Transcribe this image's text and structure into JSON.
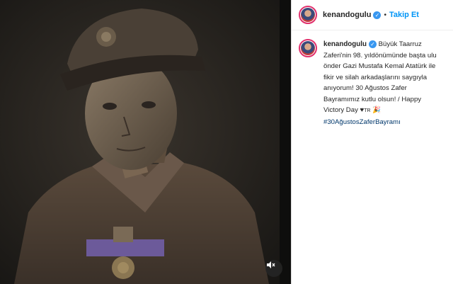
{
  "post": {
    "username": "kenandogulu",
    "follow_label": "Takip Et",
    "separator": "•",
    "caption_text": "Büyük Taarruz Zaferi'nin 98. yıldönümünde başta ulu önder Gazi Mustafa Kemal Atatürk ile fikir ve silah arkadaşlarını saygıyla anıyorum! 30 Ağustos Zafer Bayramımız kutlu olsun! / Happy Victory Day ♥",
    "caption_flag": "TR",
    "caption_emoji": "🎉",
    "hashtag": "#30AğustosZaferBayramı"
  },
  "colors": {
    "accent": "#0095f6",
    "verified": "#3897f0",
    "text": "#262626",
    "hashtag": "#00376b"
  },
  "icons": {
    "verified": "verified-badge-icon",
    "mute": "speaker-muted-icon"
  }
}
